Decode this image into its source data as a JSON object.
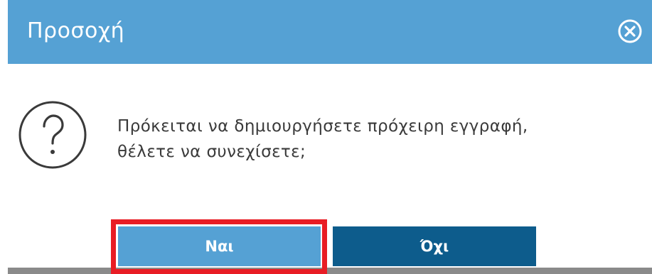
{
  "dialog": {
    "title": "Προσοχή",
    "message_line1": "Πρόκειται να δημιουργήσετε πρόχειρη εγγραφή,",
    "message_line2": "θέλετε να συνεχίσετε;",
    "yes_label": "Ναι",
    "no_label": "Όχι",
    "icons": {
      "close": "close-circle-icon",
      "question": "question-circle-icon"
    },
    "colors": {
      "titlebar": "#55a1d4",
      "yes_button": "#55a1d4",
      "no_button": "#0d5c8c",
      "highlight": "#e81c24",
      "text": "#3a3a3a"
    }
  }
}
